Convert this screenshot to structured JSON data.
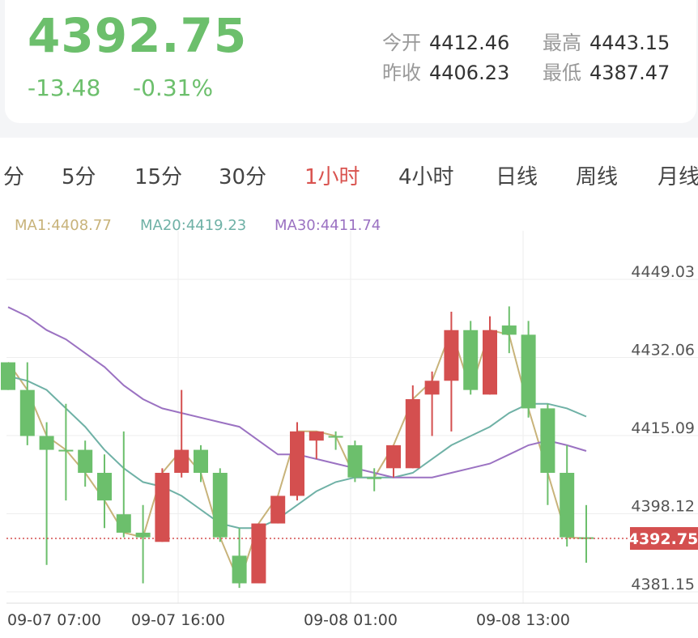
{
  "quote": {
    "price": "4392.75",
    "change": "-13.48",
    "change_pct": "-0.31%",
    "open_label": "今开",
    "open": "4412.46",
    "high_label": "最高",
    "high": "4443.15",
    "prev_close_label": "昨收",
    "prev_close": "4406.23",
    "low_label": "最低",
    "low": "4387.47"
  },
  "tabs": [
    {
      "label": "分",
      "active": false
    },
    {
      "label": "5分",
      "active": false
    },
    {
      "label": "15分",
      "active": false
    },
    {
      "label": "30分",
      "active": false
    },
    {
      "label": "1小时",
      "active": true
    },
    {
      "label": "4小时",
      "active": false
    },
    {
      "label": "日线",
      "active": false
    },
    {
      "label": "周线",
      "active": false
    },
    {
      "label": "月线",
      "active": false
    }
  ],
  "ma_legend": {
    "ma1": "MA1:4408.77",
    "ma20": "MA20:4419.23",
    "ma30": "MA30:4411.74"
  },
  "colors": {
    "up": "#d44f4f",
    "down": "#6cbf6c",
    "ma1": "#c8b37a",
    "ma20": "#6fb1a6",
    "ma30": "#9b72c2",
    "grid": "#eeeeee",
    "current": "#d44f4f"
  },
  "chart_data": {
    "type": "candlestick",
    "y_ticks": [
      "4449.03",
      "4432.06",
      "4415.09",
      "4398.12",
      "4381.15"
    ],
    "ylim": [
      4381.15,
      4449.03
    ],
    "x_ticks": [
      "09-07 07:00",
      "09-07 16:00",
      "09-08 01:00",
      "09-08 13:00"
    ],
    "current_price": "4392.75",
    "candles": [
      {
        "o": 4431.0,
        "h": 4431.0,
        "l": 4425.0,
        "c": 4425.0
      },
      {
        "o": 4425.0,
        "h": 4431.0,
        "l": 4413.0,
        "c": 4415.0
      },
      {
        "o": 4415.0,
        "h": 4418.0,
        "l": 4387.0,
        "c": 4412.0
      },
      {
        "o": 4412.0,
        "h": 4422.0,
        "l": 4401.0,
        "c": 4412.0
      },
      {
        "o": 4412.0,
        "h": 4414.0,
        "l": 4404.0,
        "c": 4407.0
      },
      {
        "o": 4407.0,
        "h": 4411.0,
        "l": 4395.0,
        "c": 4401.0
      },
      {
        "o": 4398.0,
        "h": 4416.0,
        "l": 4393.0,
        "c": 4394.0
      },
      {
        "o": 4394.0,
        "h": 4400.0,
        "l": 4383.0,
        "c": 4393.0
      },
      {
        "o": 4392.0,
        "h": 4408.0,
        "l": 4392.0,
        "c": 4407.0
      },
      {
        "o": 4407.0,
        "h": 4425.0,
        "l": 4406.0,
        "c": 4412.0
      },
      {
        "o": 4412.0,
        "h": 4413.0,
        "l": 4405.0,
        "c": 4407.0
      },
      {
        "o": 4407.0,
        "h": 4408.0,
        "l": 4392.0,
        "c": 4393.0
      },
      {
        "o": 4389.0,
        "h": 4395.0,
        "l": 4382.0,
        "c": 4383.0
      },
      {
        "o": 4383.0,
        "h": 4396.0,
        "l": 4383.0,
        "c": 4396.0
      },
      {
        "o": 4396.0,
        "h": 4402.0,
        "l": 4396.0,
        "c": 4402.0
      },
      {
        "o": 4402.0,
        "h": 4418.0,
        "l": 4401.0,
        "c": 4416.0
      },
      {
        "o": 4414.0,
        "h": 4416.0,
        "l": 4410.0,
        "c": 4416.0
      },
      {
        "o": 4415.0,
        "h": 4416.0,
        "l": 4412.0,
        "c": 4415.0
      },
      {
        "o": 4413.0,
        "h": 4414.0,
        "l": 4405.0,
        "c": 4406.0
      },
      {
        "o": 4406.0,
        "h": 4408.0,
        "l": 4403.0,
        "c": 4406.0
      },
      {
        "o": 4408.0,
        "h": 4413.0,
        "l": 4406.0,
        "c": 4413.0
      },
      {
        "o": 4408.0,
        "h": 4426.0,
        "l": 4408.0,
        "c": 4423.0
      },
      {
        "o": 4424.0,
        "h": 4429.0,
        "l": 4415.0,
        "c": 4427.0
      },
      {
        "o": 4427.0,
        "h": 4442.0,
        "l": 4416.0,
        "c": 4438.0
      },
      {
        "o": 4438.0,
        "h": 4440.0,
        "l": 4424.0,
        "c": 4425.0
      },
      {
        "o": 4424.0,
        "h": 4441.0,
        "l": 4424.0,
        "c": 4438.0
      },
      {
        "o": 4439.0,
        "h": 4443.15,
        "l": 4433.0,
        "c": 4437.0
      },
      {
        "o": 4437.0,
        "h": 4440.0,
        "l": 4419.0,
        "c": 4421.0
      },
      {
        "o": 4421.0,
        "h": 4422.0,
        "l": 4400.0,
        "c": 4407.0
      },
      {
        "o": 4407.0,
        "h": 4413.0,
        "l": 4391.0,
        "c": 4393.0
      },
      {
        "o": 4393.0,
        "h": 4400.0,
        "l": 4387.47,
        "c": 4392.75
      }
    ],
    "series": [
      {
        "name": "MA1",
        "values": [
          4431.0,
          4425.0,
          4415.0,
          4412.0,
          4407.0,
          4401.0,
          4394.0,
          4393.0,
          4407.0,
          4412.0,
          4407.0,
          4393.0,
          4383.0,
          4396.0,
          4402.0,
          4416.0,
          4416.0,
          4415.0,
          4406.0,
          4406.0,
          4413.0,
          4423.0,
          4427.0,
          4438.0,
          4425.0,
          4438.0,
          4437.0,
          4421.0,
          4407.0,
          4393.0,
          4392.75
        ]
      },
      {
        "name": "MA20",
        "values": [
          4428.0,
          4427.0,
          4425.0,
          4421.0,
          4417.0,
          4412.0,
          4408.0,
          4405.0,
          4404.0,
          4402.0,
          4399.0,
          4396.0,
          4395.0,
          4395.0,
          4397.0,
          4400.0,
          4403.0,
          4405.0,
          4406.0,
          4406.0,
          4406.0,
          4407.0,
          4410.0,
          4413.0,
          4415.0,
          4417.0,
          4420.0,
          4422.0,
          4422.0,
          4421.0,
          4419.23
        ]
      },
      {
        "name": "MA30",
        "values": [
          4443.0,
          4441.0,
          4438.0,
          4436.0,
          4433.0,
          4430.0,
          4426.0,
          4423.0,
          4421.0,
          4420.0,
          4419.0,
          4418.0,
          4417.0,
          4414.0,
          4411.0,
          4411.0,
          4410.0,
          4409.0,
          4408.0,
          4407.0,
          4406.0,
          4406.0,
          4406.0,
          4407.0,
          4408.0,
          4409.0,
          4411.0,
          4413.0,
          4414.0,
          4413.0,
          4411.74
        ]
      }
    ]
  }
}
